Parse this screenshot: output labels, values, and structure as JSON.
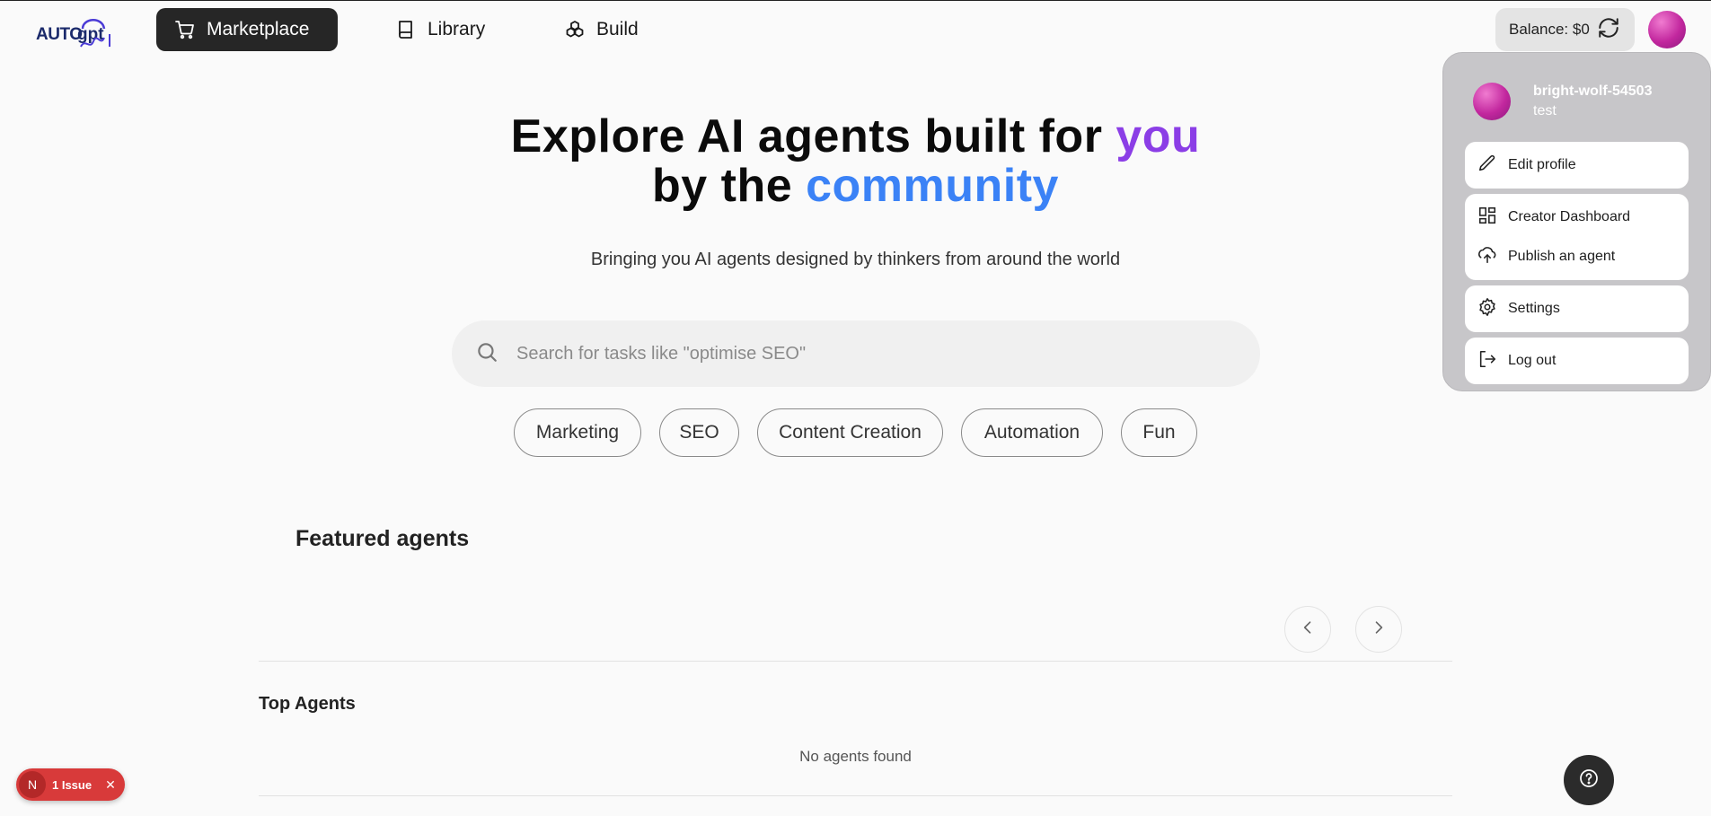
{
  "header": {
    "logo_text": "AUTOgpt",
    "nav": [
      {
        "label": "Marketplace",
        "icon": "cart-icon",
        "active": true
      },
      {
        "label": "Library",
        "icon": "book-icon",
        "active": false
      },
      {
        "label": "Build",
        "icon": "boxes-icon",
        "active": false
      }
    ],
    "balance_label": "Balance: $0"
  },
  "hero": {
    "title_part1": "Explore AI agents built for ",
    "title_highlight1": "you",
    "title_part2": "by the ",
    "title_highlight2": "community",
    "subtitle": "Bringing you AI agents designed by thinkers from around the world",
    "accent_purple": "#8b3ee6",
    "accent_blue": "#3b82f6"
  },
  "search": {
    "placeholder": "Search for tasks like \"optimise SEO\"",
    "value": ""
  },
  "chips": [
    "Marketing",
    "SEO",
    "Content Creation",
    "Automation",
    "Fun"
  ],
  "featured": {
    "title": "Featured agents"
  },
  "top_agents": {
    "title": "Top Agents",
    "empty_text": "No agents found"
  },
  "profile_menu": {
    "username": "bright-wolf-54503",
    "subtitle": "test",
    "items": {
      "edit_profile": "Edit profile",
      "creator_dashboard": "Creator Dashboard",
      "publish_agent": "Publish an agent",
      "settings": "Settings",
      "log_out": "Log out"
    }
  },
  "dev_overlay": {
    "logo_letter": "N",
    "issue_label": "1 Issue",
    "close_glyph": "✕",
    "color": "#d83a3a"
  }
}
